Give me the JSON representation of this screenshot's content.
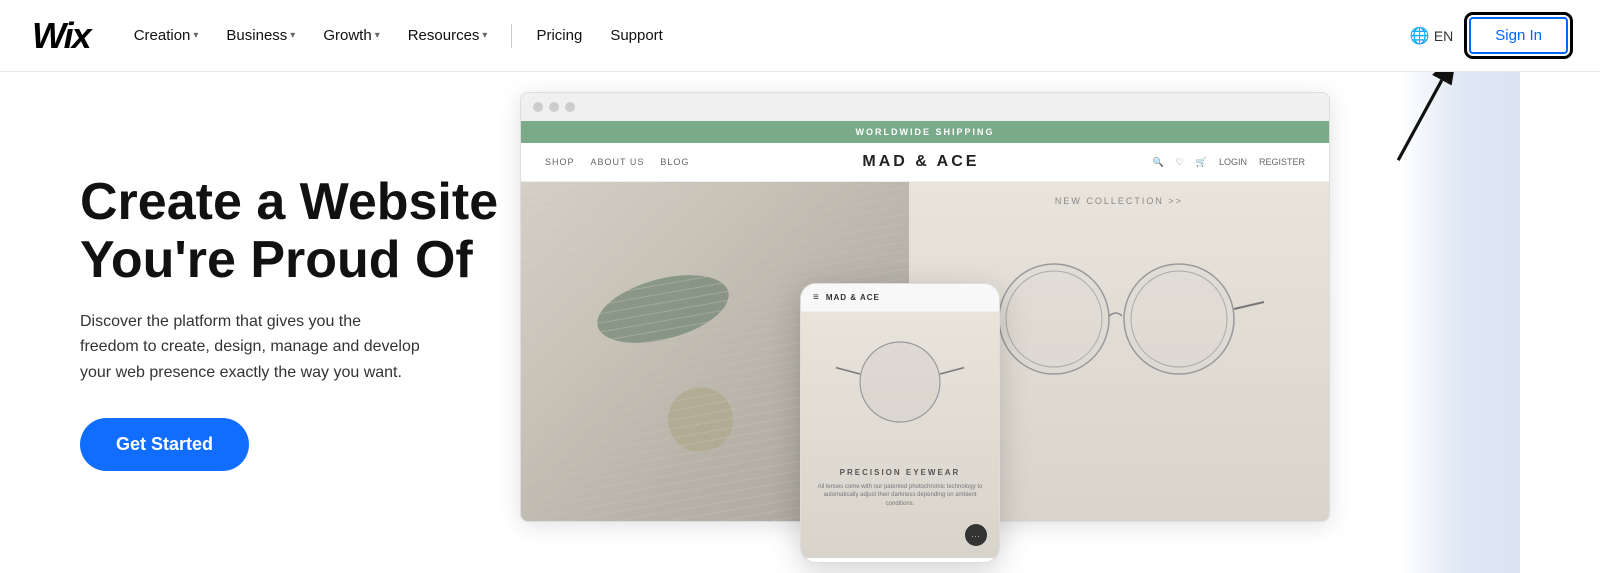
{
  "logo": {
    "text": "Wix"
  },
  "nav": {
    "items": [
      {
        "label": "Creation",
        "has_dropdown": true
      },
      {
        "label": "Business",
        "has_dropdown": true
      },
      {
        "label": "Growth",
        "has_dropdown": true
      },
      {
        "label": "Resources",
        "has_dropdown": true
      },
      {
        "label": "Pricing",
        "has_dropdown": false
      },
      {
        "label": "Support",
        "has_dropdown": false
      }
    ],
    "lang": "EN",
    "sign_in": "Sign In"
  },
  "hero": {
    "title": "Create a Website\nYou're Proud Of",
    "subtitle": "Discover the platform that gives you the freedom to create, design, manage and develop your web presence exactly the way you want.",
    "cta_label": "Get Started"
  },
  "mockup": {
    "banner_text": "WORLDWIDE SHIPPING",
    "brand_name": "MAD & ACE",
    "nav_left": [
      "SHOP",
      "ABOUT US",
      "BLOG"
    ],
    "nav_right": [
      "LOGIN",
      "REGISTER"
    ],
    "new_collection": "NEW COLLECTION >>",
    "precision_title": "PRECISION EYEWEAR",
    "precision_text": "All lenses come with our patented photochromic technology to automatically adjust their darkness depending on ambient conditions.",
    "mobile_brand": "MAD & ACE"
  },
  "annotation": {
    "arrow_direction": "up-right"
  }
}
